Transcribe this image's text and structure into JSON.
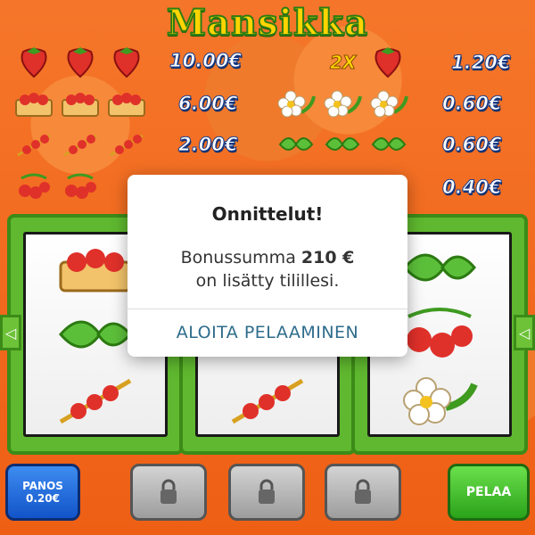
{
  "game": {
    "title": "Mansikka"
  },
  "paytable": {
    "left": [
      {
        "symbol": "strawberry-icon",
        "amount": "10.00€"
      },
      {
        "symbol": "basket-icon",
        "amount": "6.00€"
      },
      {
        "symbol": "skewer-icon",
        "amount": "2.00€"
      },
      {
        "symbol": "strawberry-bunch-icon",
        "amount": ""
      }
    ],
    "right": [
      {
        "symbol": "strawberry-icon",
        "multiplier": "2X",
        "amount": "1.20€"
      },
      {
        "symbol": "flower-icon",
        "amount": "0.60€"
      },
      {
        "symbol": "leaf-icon",
        "amount": "0.60€"
      },
      {
        "symbol": "",
        "amount": "0.40€"
      }
    ]
  },
  "reels": {
    "left": [
      "basket-icon",
      "leaf-icon",
      "skewer-icon"
    ],
    "middle": [
      "",
      "",
      "skewer-icon"
    ],
    "right": [
      "leaf-icon",
      "strawberry-bunch-icon",
      "flower-icon"
    ]
  },
  "modal": {
    "title": "Onnittelut!",
    "line1_prefix": "Bonussumma ",
    "line1_amount": "210 €",
    "line2": "on lisätty tilillesi.",
    "cta": "ALOITA PELAAMINEN"
  },
  "controls": {
    "bet_label": "PANOS",
    "bet_value": "0.20€",
    "play_label": "PELAA"
  },
  "colors": {
    "background": "#f26a1b",
    "reel_frame": "#5fb82f",
    "cta_text": "#2e6c8c"
  }
}
